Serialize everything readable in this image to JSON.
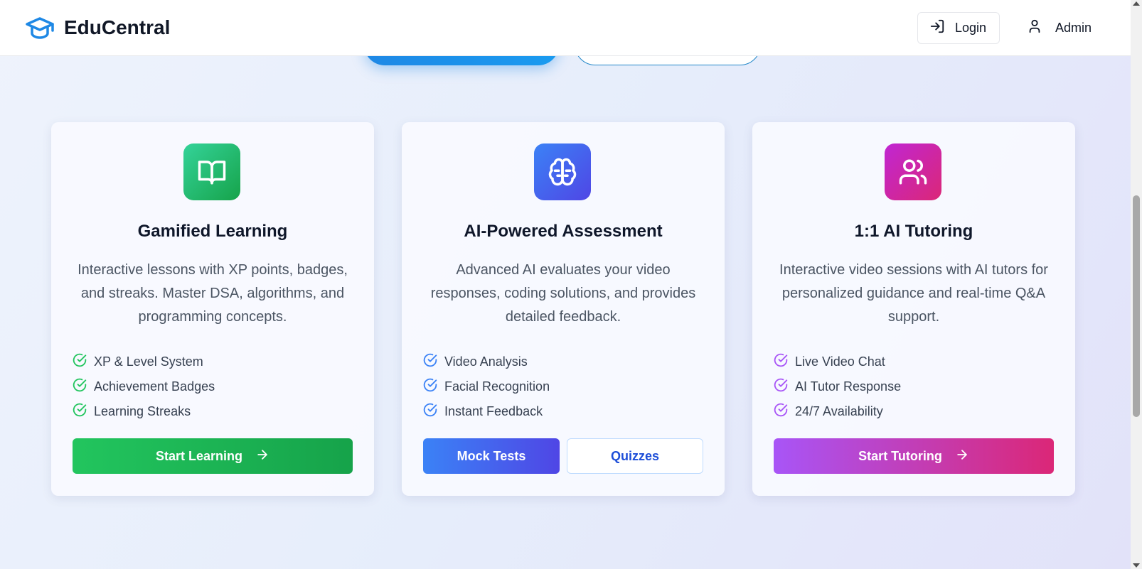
{
  "colors": {
    "brand": "#1e88e5",
    "green_start": "#22c55e",
    "green_end": "#16a34a",
    "blue_start": "#3b82f6",
    "blue_end": "#4f46e5",
    "purple_start": "#a855f7",
    "purple_end": "#db2777"
  },
  "header": {
    "brand_icon": "graduation-cap-icon",
    "brand_name": "EduCentral",
    "login_icon": "log-in-icon",
    "login_label": "Login",
    "user_icon": "user-icon",
    "admin_label": "Admin"
  },
  "cards": [
    {
      "icon": "book-open-icon",
      "title": "Gamified Learning",
      "description": "Interactive lessons with XP points, badges, and streaks. Master DSA, algorithms, and programming concepts.",
      "features": [
        "XP & Level System",
        "Achievement Badges",
        "Learning Streaks"
      ],
      "cta_label": "Start Learning",
      "cta_icon": "arrow-right-icon"
    },
    {
      "icon": "brain-icon",
      "title": "AI-Powered Assessment",
      "description": "Advanced AI evaluates your video responses, coding solutions, and provides detailed feedback.",
      "features": [
        "Video Analysis",
        "Facial Recognition",
        "Instant Feedback"
      ],
      "primary_label": "Mock Tests",
      "secondary_label": "Quizzes"
    },
    {
      "icon": "users-icon",
      "title": "1:1 AI Tutoring",
      "description": "Interactive video sessions with AI tutors for personalized guidance and real-time Q&A support.",
      "features": [
        "Live Video Chat",
        "AI Tutor Response",
        "24/7 Availability"
      ],
      "cta_label": "Start Tutoring",
      "cta_icon": "arrow-right-icon"
    }
  ]
}
